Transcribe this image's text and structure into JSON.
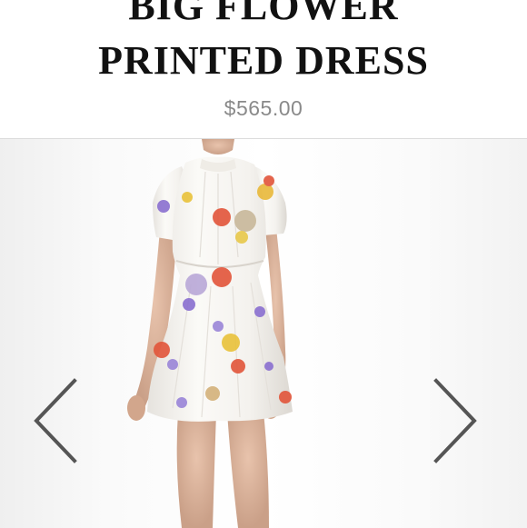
{
  "product": {
    "title_line1": "BIG FLOWER",
    "title_line2": "PRINTED DRESS",
    "price": "$565.00"
  },
  "gallery": {
    "prev_icon": "chevron-left-icon",
    "next_icon": "chevron-right-icon",
    "arrow_color": "#555555"
  },
  "colors": {
    "title": "#111111",
    "price": "#8a8a8a",
    "background": "#ffffff"
  }
}
